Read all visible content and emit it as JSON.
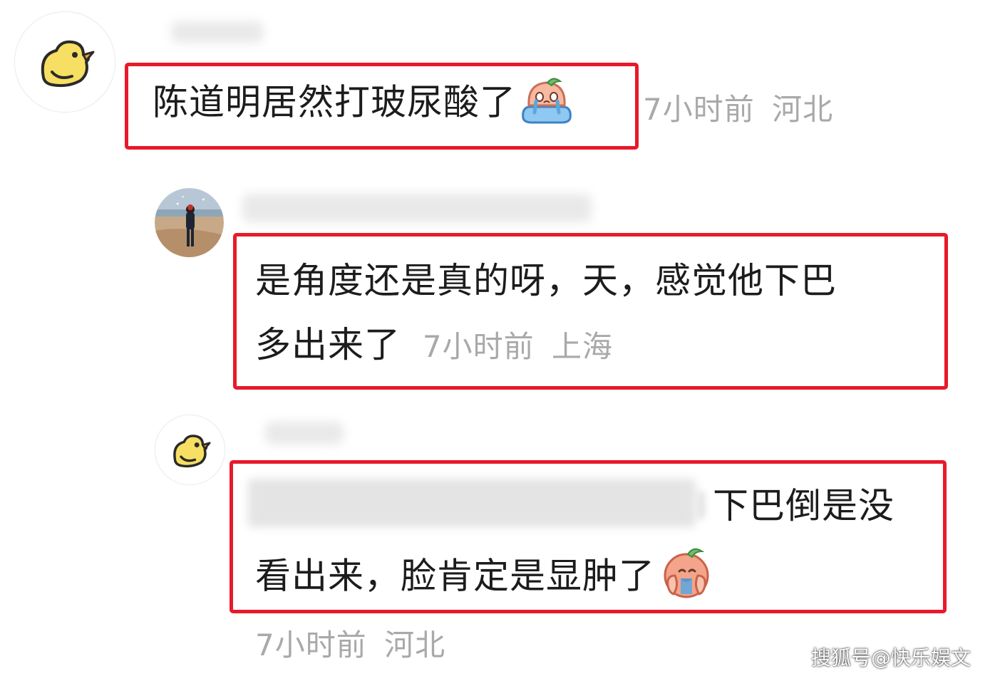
{
  "comments": [
    {
      "text": "陈道明居然打玻尿酸了",
      "emoji": "crying-face-emoji",
      "time": "7小时前",
      "location": "河北",
      "avatar": "yellow-chick-avatar"
    },
    {
      "line1": "是角度还是真的呀，天，感觉他下巴",
      "line2": "多出来了",
      "time": "7小时前",
      "location": "上海",
      "avatar": "beach-photo-avatar"
    },
    {
      "line1": "下巴倒是没",
      "line2": "看出来，脸肯定是显肿了",
      "emoji": "crying-face-emoji",
      "time": "7小时前",
      "location": "河北",
      "avatar": "yellow-chick-avatar"
    }
  ],
  "watermark": "搜狐号@快乐娱文",
  "colors": {
    "highlight": "#e8192a",
    "meta_text": "#a9a9a9",
    "body_text": "#1c1c1c"
  }
}
